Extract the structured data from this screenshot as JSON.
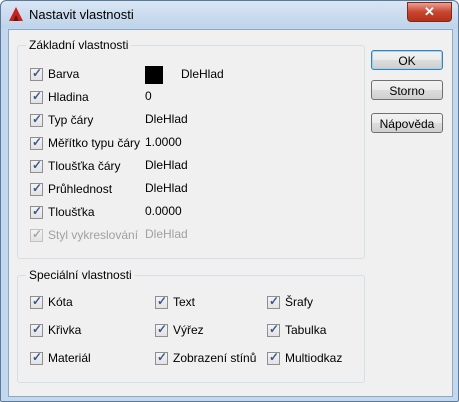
{
  "window": {
    "title": "Nastavit vlastnosti",
    "close_label": "✕"
  },
  "basic": {
    "legend": "Základní vlastnosti",
    "items": [
      {
        "label": "Barva",
        "checked": true,
        "enabled": true,
        "value": "DleHlad",
        "swatch_color": "#000000"
      },
      {
        "label": "Hladina",
        "checked": true,
        "enabled": true,
        "value": "0"
      },
      {
        "label": "Typ čáry",
        "checked": true,
        "enabled": true,
        "value": "DleHlad"
      },
      {
        "label": "Měřítko typu čáry",
        "checked": true,
        "enabled": true,
        "value": "1.0000"
      },
      {
        "label": "Tloušťka čáry",
        "checked": true,
        "enabled": true,
        "value": "DleHlad"
      },
      {
        "label": "Průhlednost",
        "checked": true,
        "enabled": true,
        "value": "DleHlad"
      },
      {
        "label": "Tloušťka",
        "checked": true,
        "enabled": true,
        "value": "0.0000"
      },
      {
        "label": "Styl vykreslování",
        "checked": true,
        "enabled": false,
        "value": "DleHlad"
      }
    ]
  },
  "special": {
    "legend": "Speciální vlastnosti",
    "items": [
      {
        "label": "Kóta",
        "checked": true
      },
      {
        "label": "Text",
        "checked": true
      },
      {
        "label": "Šrafy",
        "checked": true
      },
      {
        "label": "Křivka",
        "checked": true
      },
      {
        "label": "Výřez",
        "checked": true
      },
      {
        "label": "Tabulka",
        "checked": true
      },
      {
        "label": "Materiál",
        "checked": true
      },
      {
        "label": "Zobrazení stínů",
        "checked": true
      },
      {
        "label": "Multiodkaz",
        "checked": true
      }
    ]
  },
  "buttons": {
    "ok": "OK",
    "cancel": "Storno",
    "help": "Nápověda"
  }
}
